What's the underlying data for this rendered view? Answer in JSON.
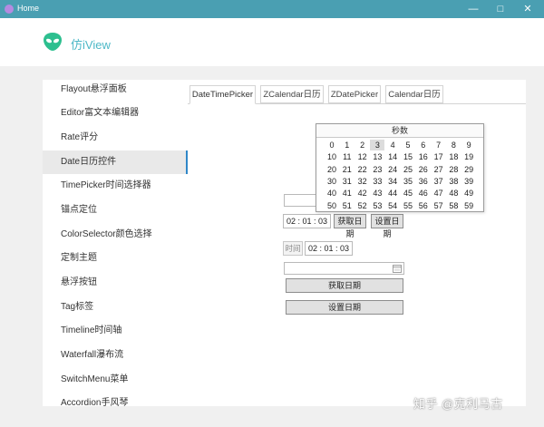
{
  "window": {
    "title": "Home"
  },
  "header": {
    "app_title": "仿iView"
  },
  "sidebar": {
    "items": [
      {
        "label": "Flayout悬浮面板"
      },
      {
        "label": "Editor富文本编辑器"
      },
      {
        "label": "Rate评分"
      },
      {
        "label": "Date日历控件",
        "active": true
      },
      {
        "label": "TimePicker时间选择器"
      },
      {
        "label": "锚点定位"
      },
      {
        "label": "ColorSelector颜色选择"
      },
      {
        "label": "定制主题"
      },
      {
        "label": "悬浮按钮"
      },
      {
        "label": "Tag标签"
      },
      {
        "label": "Timeline时间轴"
      },
      {
        "label": "Waterfall瀑布流"
      },
      {
        "label": "SwitchMenu菜单"
      },
      {
        "label": "Accordion手风琴"
      }
    ]
  },
  "tabs": [
    {
      "label": "DateTimePicker",
      "active": true
    },
    {
      "label": "ZCalendar日历"
    },
    {
      "label": "ZDatePicker"
    },
    {
      "label": "Calendar日历"
    }
  ],
  "seconds_popup": {
    "header": "秒数",
    "selected": 3,
    "values": [
      "0",
      "1",
      "2",
      "3",
      "4",
      "5",
      "6",
      "7",
      "8",
      "9",
      "10",
      "11",
      "12",
      "13",
      "14",
      "15",
      "16",
      "17",
      "18",
      "19",
      "20",
      "21",
      "22",
      "23",
      "24",
      "25",
      "26",
      "27",
      "28",
      "29",
      "30",
      "31",
      "32",
      "33",
      "34",
      "35",
      "36",
      "37",
      "38",
      "39",
      "40",
      "41",
      "42",
      "43",
      "44",
      "45",
      "46",
      "47",
      "48",
      "49",
      "50",
      "51",
      "52",
      "53",
      "54",
      "55",
      "56",
      "57",
      "58",
      "59"
    ]
  },
  "picker1": {
    "time": "02 : 01 : 03",
    "get_button": "获取日期",
    "set_button": "设置日期"
  },
  "picker2": {
    "label": "时间",
    "time": "02 : 01 : 03"
  },
  "picker3": {
    "get_button": "获取日期",
    "set_button": "设置日期"
  },
  "watermark": "知乎 @克利马古",
  "colors": {
    "titlebar": "#4a9fb2",
    "accent": "#4db8c7",
    "active_border": "#2f87c8"
  }
}
